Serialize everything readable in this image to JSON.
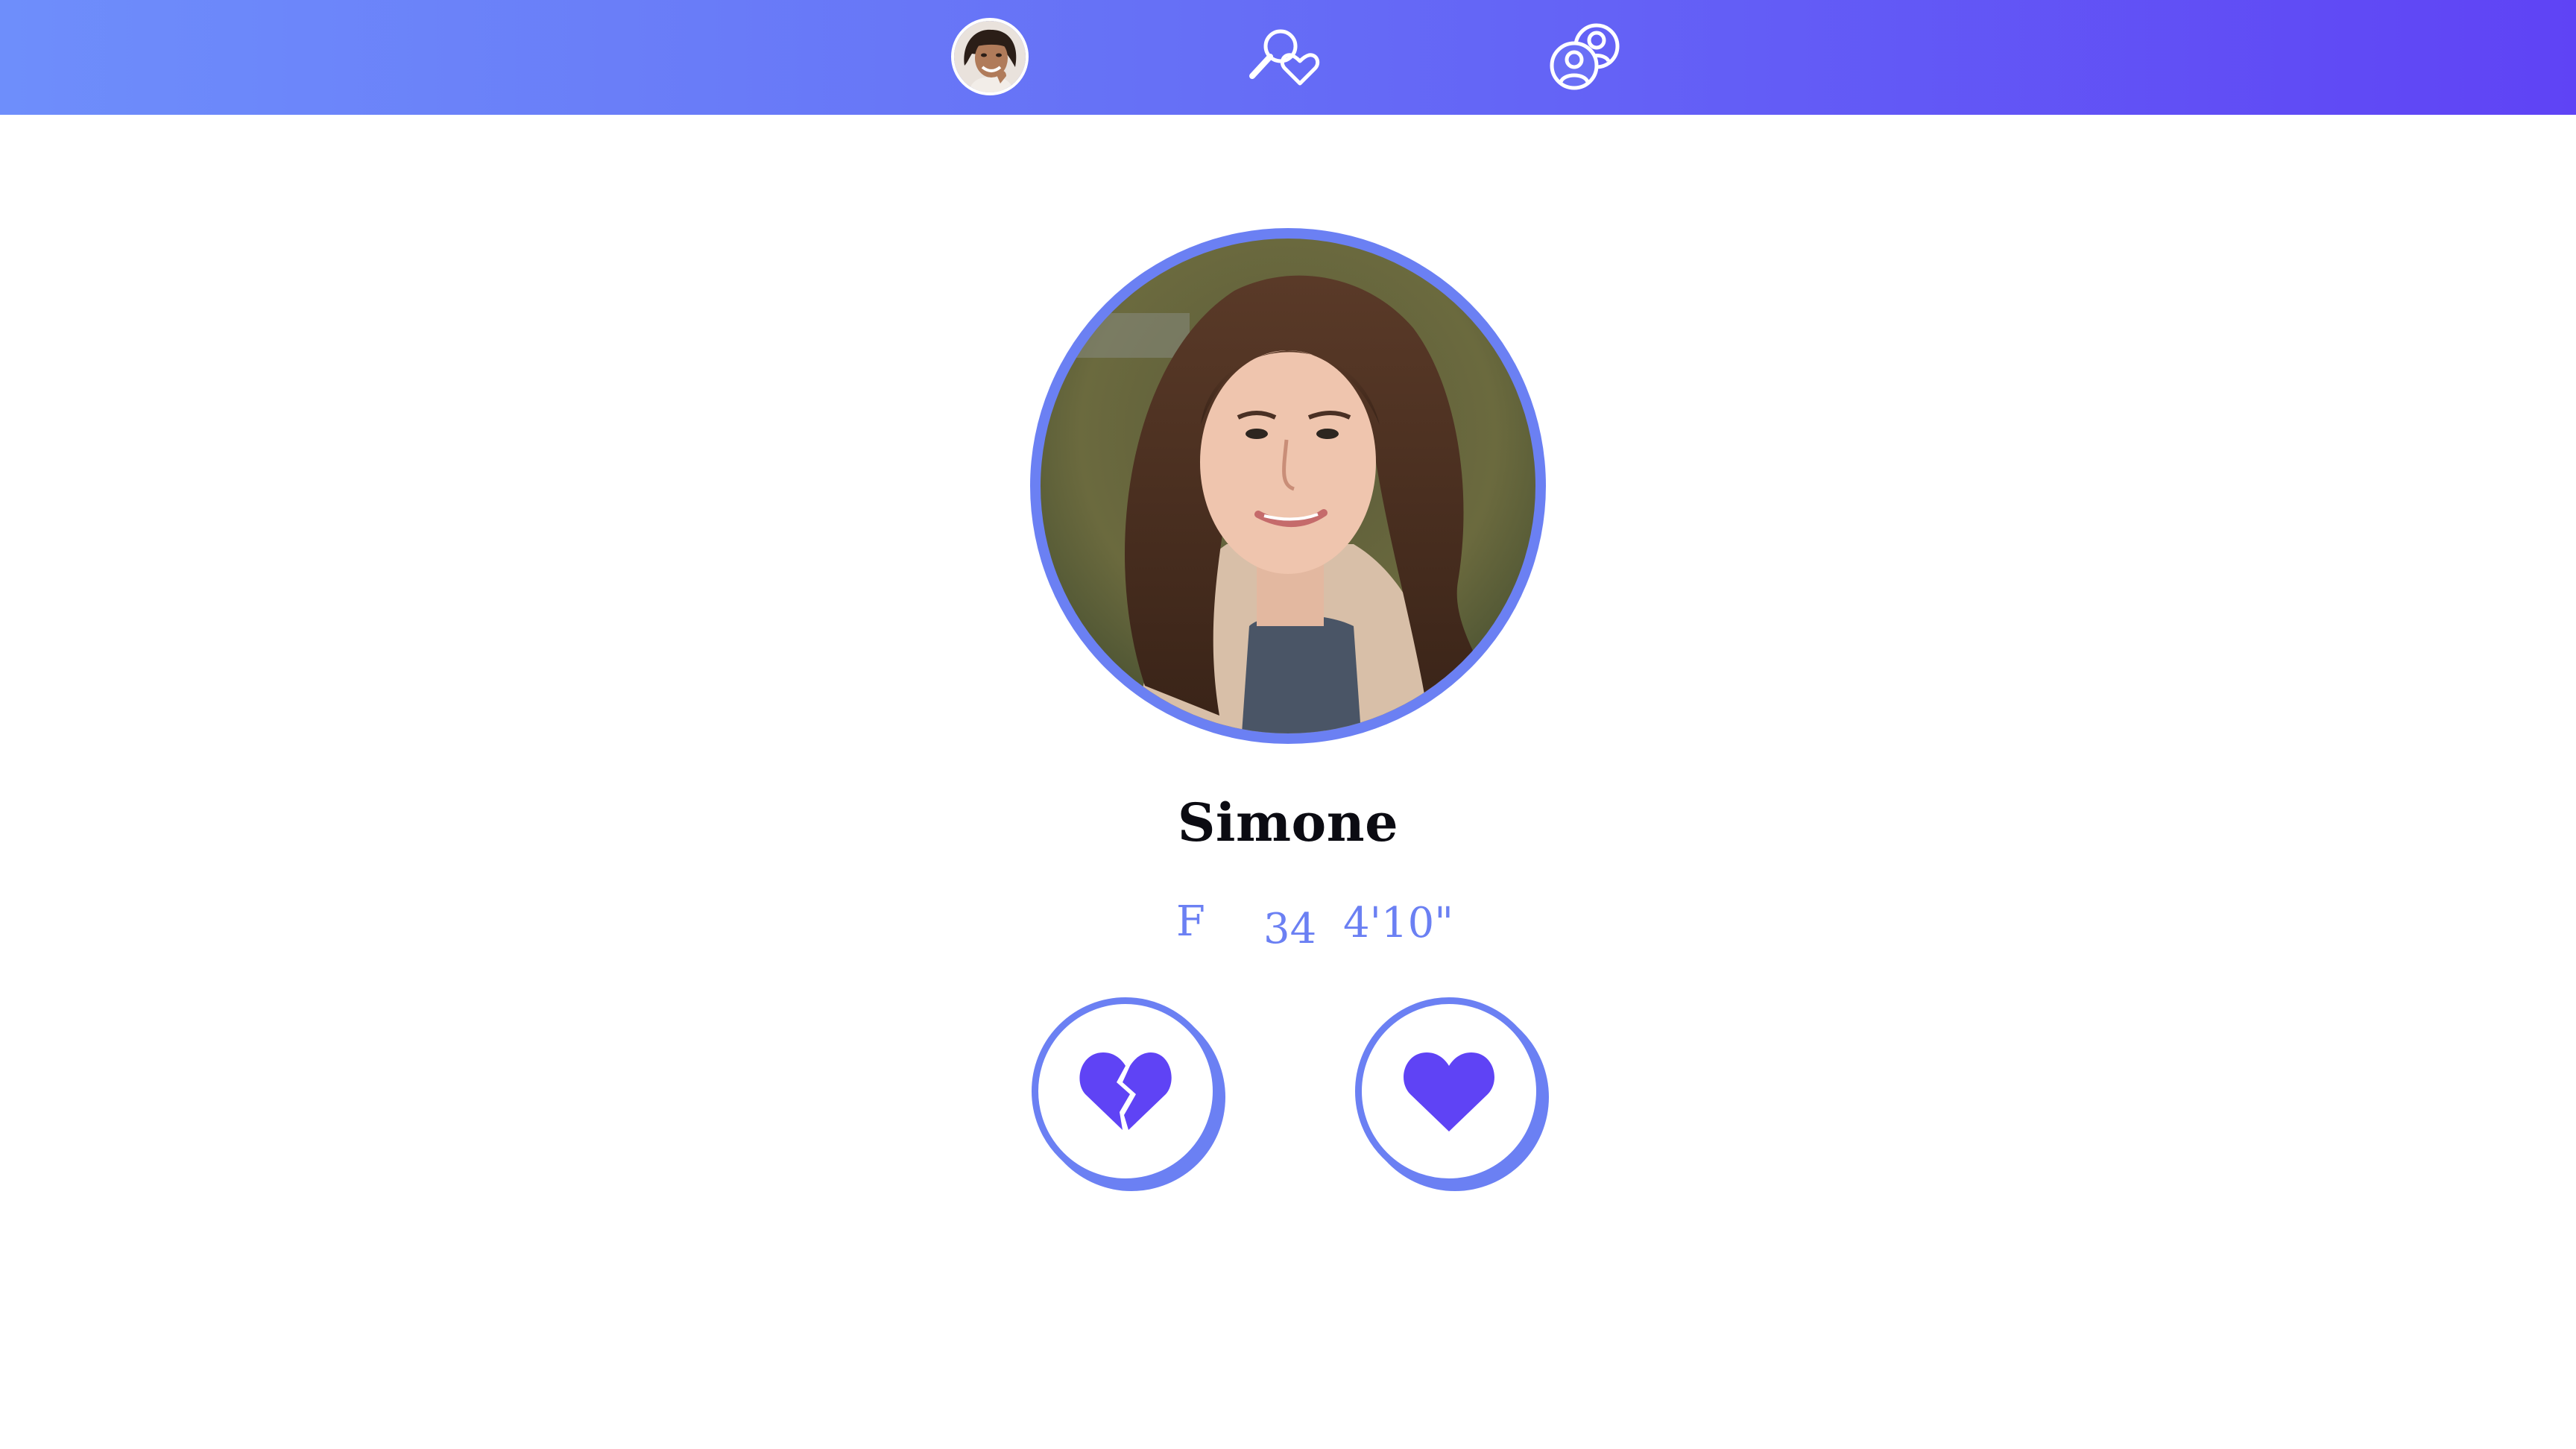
{
  "nav": {
    "items": [
      {
        "id": "profile",
        "icon": "user-avatar"
      },
      {
        "id": "discover",
        "icon": "search-heart-icon"
      },
      {
        "id": "matches",
        "icon": "users-icon"
      }
    ],
    "gradient_start": "#6e8efb",
    "gradient_end": "#5f43f5"
  },
  "profile": {
    "name": "Simone",
    "sex": "F",
    "age": "34",
    "height": "4'10\""
  },
  "actions": {
    "pass_icon": "broken-heart-icon",
    "like_icon": "heart-icon"
  },
  "colors": {
    "accent": "#6b80f3",
    "icon_fill": "#5f43f5",
    "name_text": "#0b0b12"
  }
}
